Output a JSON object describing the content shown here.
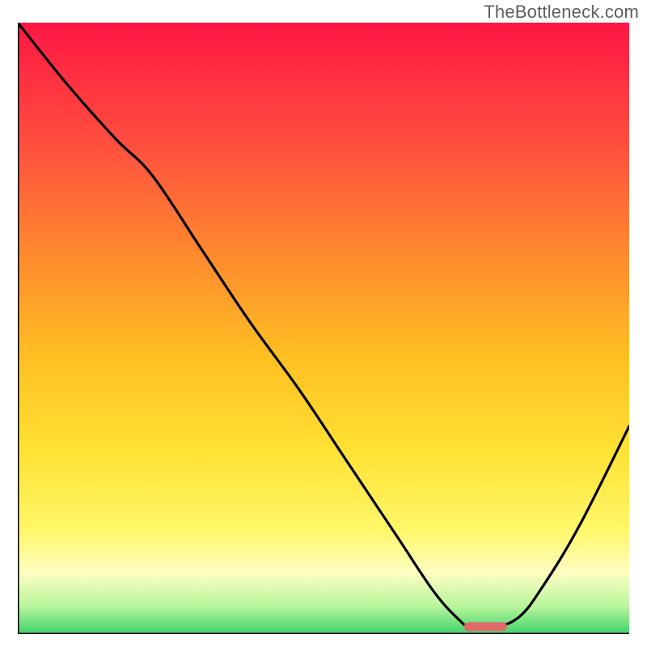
{
  "watermark": "TheBottleneck.com",
  "colors": {
    "gradient_top": "#ff1744",
    "gradient_upper": "#ff4f3e",
    "gradient_mid_high": "#ff8a2e",
    "gradient_mid": "#ffc022",
    "gradient_mid_low": "#ffe233",
    "gradient_low": "#fff76a",
    "gradient_lower": "#fdfec2",
    "gradient_near_bottom": "#b8f59c",
    "gradient_bottom": "#3ed36b",
    "curve": "#000000",
    "marker_fill": "#e06a6a",
    "axis": "#000000"
  },
  "chart_data": {
    "type": "line",
    "title": "",
    "xlabel": "",
    "ylabel": "",
    "xlim": [
      0,
      100
    ],
    "ylim": [
      0,
      100
    ],
    "grid": false,
    "legend": false,
    "annotations": [],
    "series": [
      {
        "name": "curve",
        "x": [
          0,
          8,
          16,
          22,
          30,
          38,
          46,
          54,
          62,
          68,
          72,
          74,
          78,
          82,
          86,
          92,
          100
        ],
        "y": [
          100,
          90,
          81,
          75,
          63,
          51,
          40,
          28,
          16,
          7,
          2.5,
          1.2,
          1.2,
          2.8,
          8,
          18,
          34
        ]
      }
    ],
    "marker": {
      "name": "optimum-marker",
      "x_range": [
        73,
        80
      ],
      "y": 1.2
    }
  }
}
